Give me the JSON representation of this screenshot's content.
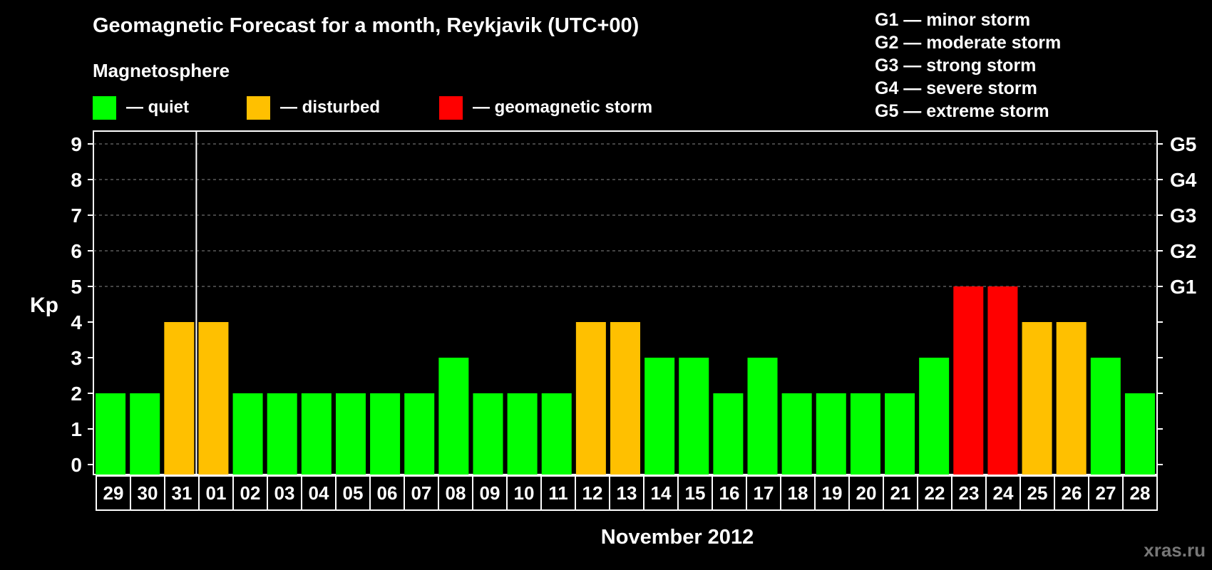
{
  "title": "Geomagnetic Forecast for a month, Reykjavik (UTC+00)",
  "subtitle": "Magnetosphere",
  "legend": [
    {
      "label": "— quiet",
      "color": "#00ff00"
    },
    {
      "label": "— disturbed",
      "color": "#ffc000"
    },
    {
      "label": "— geomagnetic storm",
      "color": "#ff0000"
    }
  ],
  "g_legend": [
    "G1 — minor storm",
    "G2 — moderate storm",
    "G3 — strong storm",
    "G4 — severe storm",
    "G5 — extreme storm"
  ],
  "watermark": "xras.ru",
  "chart_data": {
    "type": "bar",
    "title": "Geomagnetic Forecast for a month, Reykjavik (UTC+00)",
    "ylabel": "Kp",
    "xlabel": "November 2012",
    "ylim": [
      0,
      9
    ],
    "yticks": [
      0,
      1,
      2,
      3,
      4,
      5,
      6,
      7,
      8,
      9
    ],
    "right_axis_labels": [
      {
        "value": 5,
        "label": "G1"
      },
      {
        "value": 6,
        "label": "G2"
      },
      {
        "value": 7,
        "label": "G3"
      },
      {
        "value": 8,
        "label": "G4"
      },
      {
        "value": 9,
        "label": "G5"
      }
    ],
    "grid": "dashed horizontal lines at 5-9",
    "month_separator_after": "31",
    "categories": [
      "29",
      "30",
      "31",
      "01",
      "02",
      "03",
      "04",
      "05",
      "06",
      "07",
      "08",
      "09",
      "10",
      "11",
      "12",
      "13",
      "14",
      "15",
      "16",
      "17",
      "18",
      "19",
      "20",
      "21",
      "22",
      "23",
      "24",
      "25",
      "26",
      "27",
      "28"
    ],
    "values": [
      2,
      2,
      4,
      4,
      2,
      2,
      2,
      2,
      2,
      2,
      3,
      2,
      2,
      2,
      4,
      4,
      3,
      3,
      2,
      3,
      2,
      2,
      2,
      2,
      3,
      5,
      5,
      4,
      4,
      3,
      2
    ],
    "colors": {
      "quiet": "#00ff00",
      "disturbed": "#ffc000",
      "storm": "#ff0000"
    }
  }
}
